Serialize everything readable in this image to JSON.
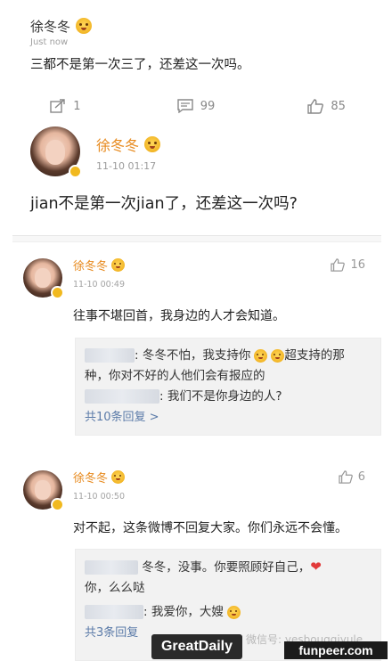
{
  "post": {
    "author": "徐冬冬",
    "time": "Just now",
    "text": "三都不是第一次三了，还差这一次吗。"
  },
  "actions": {
    "repost_count": "1",
    "comment_count": "99",
    "like_count": "85"
  },
  "featured_comment": {
    "name": "徐冬冬",
    "time": "11-10 01:17",
    "text": "jian不是第一次jian了，还差这一次吗?"
  },
  "comments": [
    {
      "name": "徐冬冬",
      "time": "11-10 00:49",
      "likes": "16",
      "text": "往事不堪回首，我身边的人才会知道。",
      "replies": [
        {
          "line1": ": 冬冬不怕，我支持你",
          "line1_tail": "超支持的那",
          "line2": "种，你对不好的人他们会有报应的"
        },
        {
          "line1": ": 我们不是你身边的人?"
        }
      ],
      "more": "共10条回复 >"
    },
    {
      "name": "徐冬冬",
      "time": "11-10 00:50",
      "likes": "6",
      "text": "对不起，这条微博不回复大家。你们永远不会懂。",
      "replies": [
        {
          "line1": "冬冬，没事。你要照顾好自己，",
          "line2": "你，么么哒"
        },
        {
          "line1": ": 我爱你，大嫂"
        }
      ],
      "more": "共3条回复"
    }
  ],
  "watermarks": {
    "greatdaily": "GreatDaily",
    "wechat": "微信号: yesbougqiyule",
    "funpeer": "funpeer.com"
  }
}
